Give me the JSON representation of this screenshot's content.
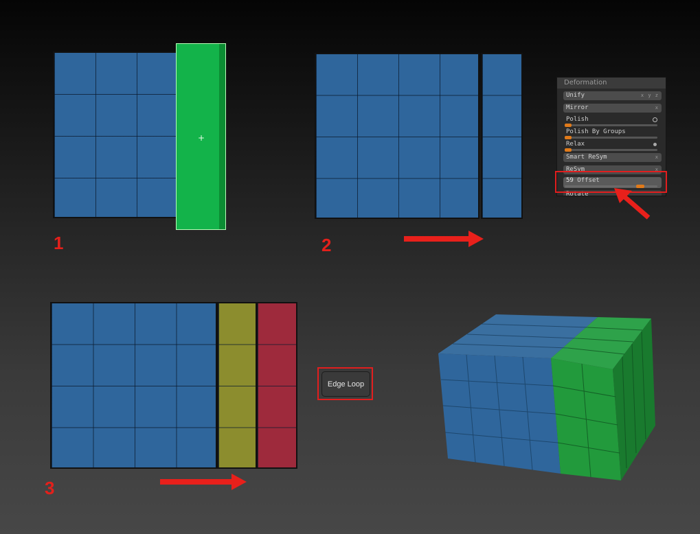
{
  "steps": {
    "one": "1",
    "two": "2",
    "three": "3"
  },
  "deformation_panel": {
    "title": "Deformation",
    "items": [
      {
        "label": "Unify",
        "kind": "button",
        "flags": "x y z"
      },
      {
        "label": "Mirror",
        "kind": "button",
        "flags": "x"
      },
      {
        "label": "Polish",
        "kind": "slider",
        "indicator": "radio-outline"
      },
      {
        "label": "Polish By Groups",
        "kind": "slider"
      },
      {
        "label": "Relax",
        "kind": "slider",
        "indicator": "radio-dot"
      },
      {
        "label": "Smart ReSym",
        "kind": "button",
        "flags": "x"
      },
      {
        "label": "ReSym",
        "kind": "button",
        "flags": "x"
      },
      {
        "label": "Offset",
        "kind": "slider",
        "value": "59",
        "highlighted": true
      },
      {
        "label": "Rotate",
        "kind": "button"
      }
    ]
  },
  "edge_loop_button": {
    "label": "Edge Loop"
  },
  "colors": {
    "mesh_blue": "#2f669c",
    "mask_green": "#13b34a",
    "polygroup_olive": "#8c8d2e",
    "polygroup_crimson": "#9e2a3c",
    "cube_green": "#229a3c",
    "highlight_red": "#e21e1e",
    "slider_orange": "#e07a1a"
  },
  "icons": [
    "move-cursor-icon",
    "arrow-right-icon",
    "pointer-arrow-icon"
  ]
}
